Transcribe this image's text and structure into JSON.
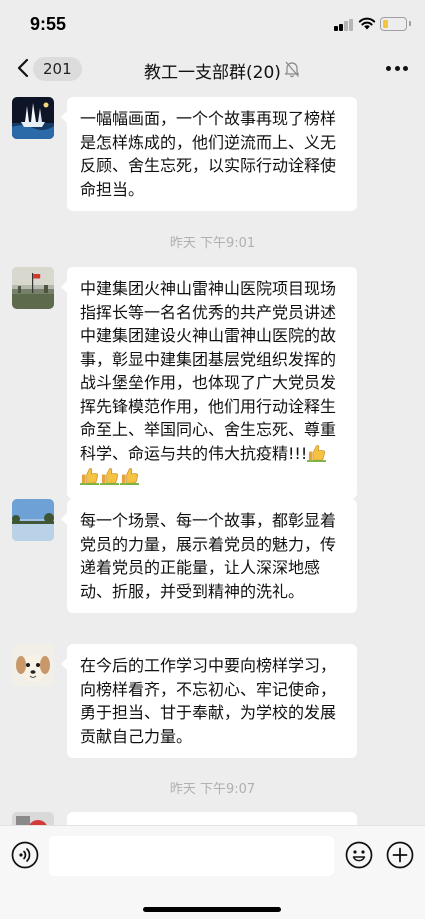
{
  "status_bar": {
    "time": "9:55",
    "battery_level": 0.25,
    "battery_color": "#f2c53d"
  },
  "nav": {
    "unread_count": "201",
    "title": "教工一支部群(20)"
  },
  "messages": [
    {
      "text": "一幅幅画面，一个个故事再现了榜样是怎样炼成的，他们逆流而上、义无反顾、舍生忘死，以实际行动诠释使命担当。",
      "avatar": "ship-photo-avatar"
    },
    {
      "text": "中建集团火神山雷神山医院项目现场指挥长等一名名优秀的共产党员讲述中建集团建设火神山雷神山医院的故事，彰显中建集团基层党组织发挥的战斗堡垒作用，也体现了广大党员发挥先锋模范作用，他们用行动诠释生命至上、举国同心、舍生忘死、尊重科学、命运与共的伟大抗疫精!!!",
      "emoji": [
        "thumbs-up",
        "thumbs-up",
        "thumbs-up",
        "thumbs-up"
      ],
      "avatar": "flag-photo-avatar"
    },
    {
      "text": "每一个场景、每一个故事，都彰显着党员的力量，展示着党员的魅力，传递着党员的正能量，让人深深地感动、折服，并受到精神的洗礼。",
      "avatar": "lake-photo-avatar"
    },
    {
      "text": "在今后的工作学习中要向榜样学习，向榜样看齐，不忘初心、牢记使命，勇于担当、甘于奉献，为学校的发展贡献自己力量。",
      "avatar": "puppy-photo-avatar"
    }
  ],
  "timestamps": [
    "昨天 下午9:01",
    "昨天 下午9:07"
  ],
  "input": {
    "value": "",
    "placeholder": ""
  }
}
